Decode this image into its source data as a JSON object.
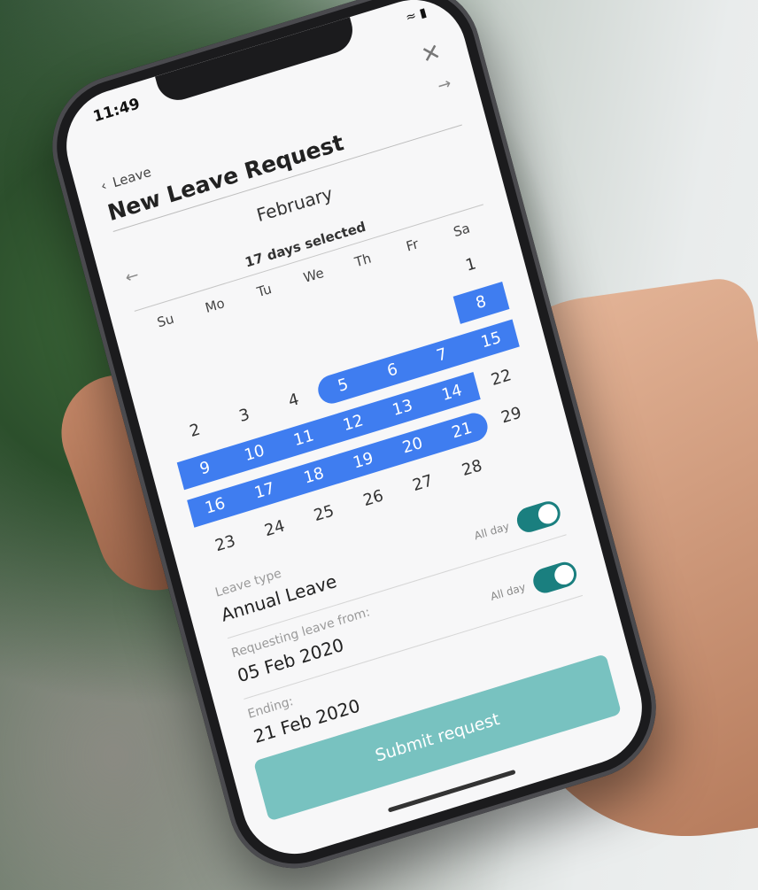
{
  "status": {
    "time": "11:49",
    "icons": "wifi-battery"
  },
  "header": {
    "back_label": "Leave",
    "title": "New Leave Request"
  },
  "calendar": {
    "month": "February",
    "days_selected": "17 days selected",
    "weekdays": [
      "Su",
      "Mo",
      "Tu",
      "We",
      "Th",
      "Fr",
      "Sa"
    ],
    "weeks": [
      [
        "",
        "",
        "",
        "",
        "",
        "",
        "1"
      ],
      [
        "",
        "",
        "",
        "",
        "",
        "",
        "8"
      ],
      [
        "2",
        "3",
        "4",
        "5",
        "6",
        "7",
        "15"
      ],
      [
        "9",
        "10",
        "11",
        "12",
        "13",
        "14",
        "22"
      ],
      [
        "16",
        "17",
        "18",
        "19",
        "20",
        "21",
        "29"
      ],
      [
        "23",
        "24",
        "25",
        "26",
        "27",
        "28",
        ""
      ]
    ],
    "selection_start": "5",
    "selection_end": "21",
    "accent_color": "#3f7df0"
  },
  "form": {
    "leave_type_label": "Leave type",
    "leave_type_value": "Annual Leave",
    "from_label": "Requesting leave from:",
    "from_value": "05 Feb 2020",
    "from_allday_label": "All day",
    "from_allday_on": true,
    "end_label": "Ending:",
    "end_value": "21 Feb 2020",
    "end_allday_label": "All day",
    "end_allday_on": true,
    "toggle_color": "#1a7f7f"
  },
  "submit": {
    "label": "Submit request",
    "color": "#78c2c0"
  }
}
